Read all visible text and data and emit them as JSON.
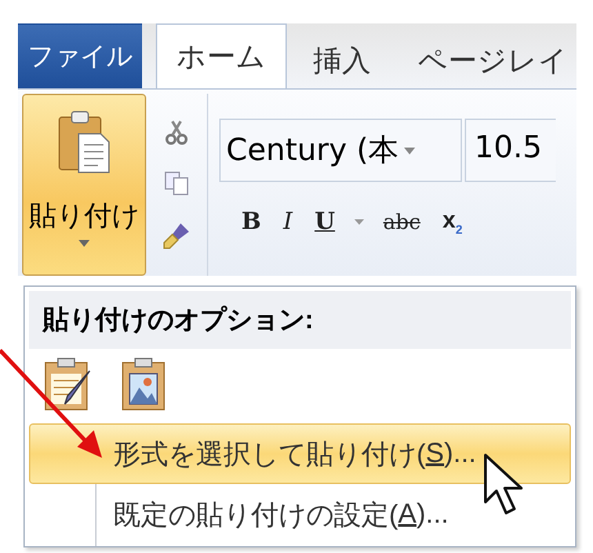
{
  "tabs": [
    {
      "label": "ファイル",
      "kind": "file",
      "selected": false
    },
    {
      "label": "ホーム",
      "kind": "tab",
      "selected": true
    },
    {
      "label": "挿入",
      "kind": "tab",
      "selected": false
    },
    {
      "label": "ページレイ",
      "kind": "tab",
      "selected": false
    }
  ],
  "ribbon": {
    "paste_button": {
      "label": "貼り付け",
      "pressed": true
    },
    "font": {
      "name": "Century (本",
      "size": "10.5"
    },
    "format_buttons": [
      {
        "label": "B",
        "kind": "bold"
      },
      {
        "label": "I",
        "kind": "italic"
      },
      {
        "label": "U",
        "kind": "underline"
      },
      {
        "label": "abc",
        "kind": "strike"
      },
      {
        "label": "x$_{2}$",
        "kind": "subscript"
      }
    ]
  },
  "paste_menu": {
    "header": "貼り付けのオプション:",
    "options": [
      {
        "kind": "keep_format"
      },
      {
        "kind": "picture"
      }
    ],
    "items": [
      {
        "text_before": "形式を選択して貼り付け(",
        "access_key": "S",
        "text_after": ")...",
        "selected": true
      },
      {
        "text_before": "既定の貼り付けの設定(",
        "access_key": "A",
        "text_after": ")...",
        "selected": false
      }
    ]
  }
}
